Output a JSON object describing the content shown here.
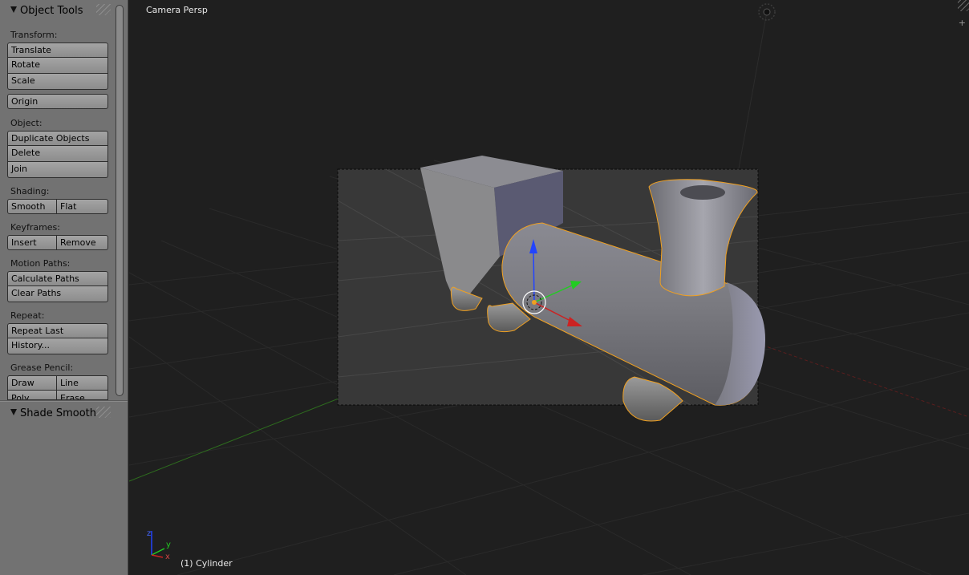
{
  "tool_shelf": {
    "object_tools": {
      "title": "Object Tools",
      "transform": {
        "label": "Transform:",
        "translate": "Translate",
        "rotate": "Rotate",
        "scale": "Scale",
        "origin": "Origin"
      },
      "object": {
        "label": "Object:",
        "duplicate": "Duplicate Objects",
        "delete": "Delete",
        "join": "Join"
      },
      "shading": {
        "label": "Shading:",
        "smooth": "Smooth",
        "flat": "Flat"
      },
      "keyframes": {
        "label": "Keyframes:",
        "insert": "Insert",
        "remove": "Remove"
      },
      "motion_paths": {
        "label": "Motion Paths:",
        "calculate": "Calculate Paths",
        "clear": "Clear Paths"
      },
      "repeat": {
        "label": "Repeat:",
        "repeat_last": "Repeat Last",
        "history": "History..."
      },
      "grease_pencil": {
        "label": "Grease Pencil:",
        "draw": "Draw",
        "line": "Line",
        "poly": "Poly",
        "erase": "Erase"
      }
    },
    "operator_panel": {
      "title": "Shade Smooth"
    }
  },
  "viewport": {
    "view_label": "Camera Persp",
    "object_label": "(1) Cylinder",
    "axis_labels": {
      "x": "x",
      "y": "y",
      "z": "z"
    },
    "plus_glyph": "+",
    "colors": {
      "background": "#1f1f1f",
      "selection_outline": "#f0a020",
      "x_axis": "#cc2222",
      "y_axis": "#22cc22",
      "z_axis": "#2244ff"
    }
  }
}
